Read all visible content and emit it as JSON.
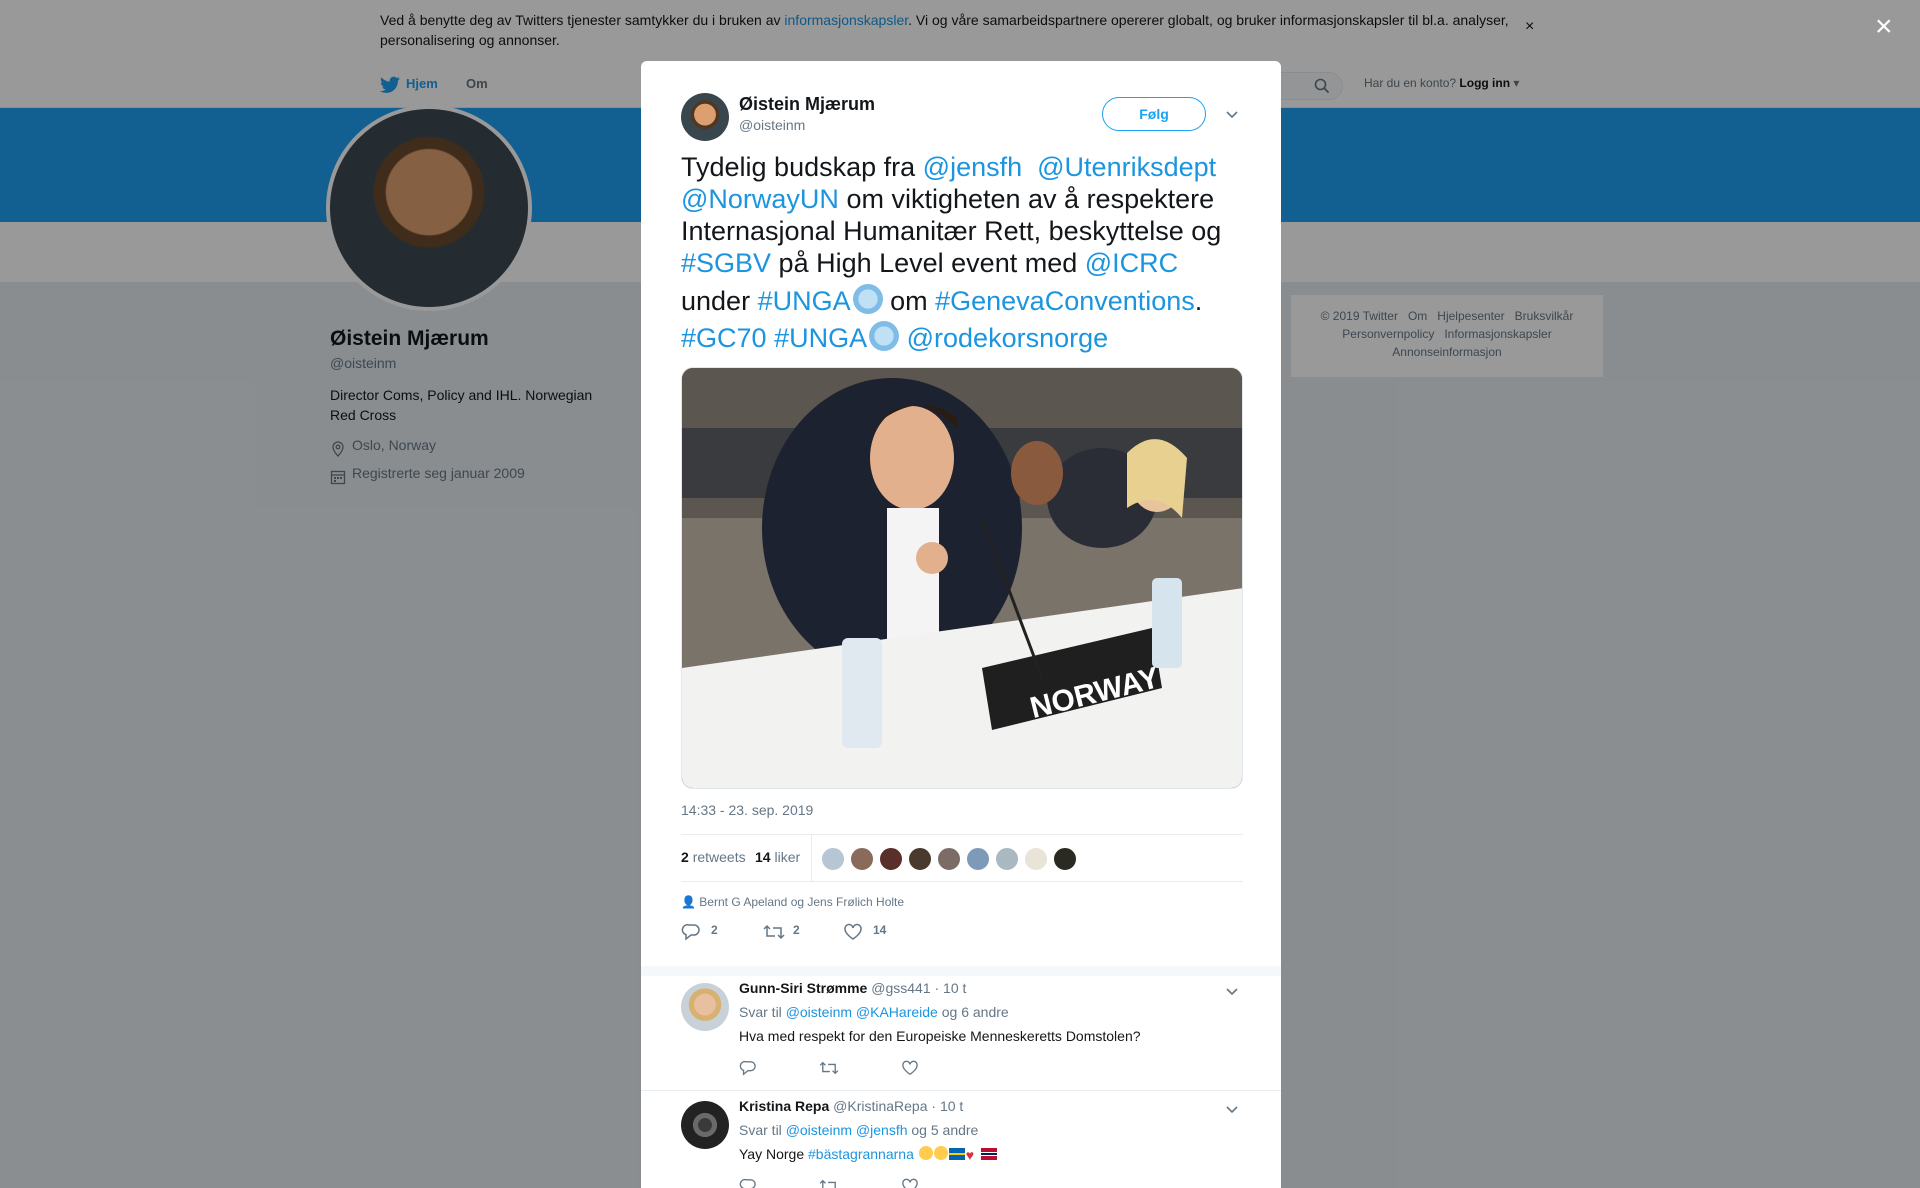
{
  "cookie": {
    "text_before": "Ved å benytte deg av Twitters tjenester samtykker du i bruken av ",
    "link": "informasjonskapsler",
    "text_after": ". Vi og våre samarbeidspartnere opererer globalt, og bruker informasjonskapsler til bl.a. analyser, personalisering og annonser.",
    "close_glyph": "×"
  },
  "nav": {
    "home": "Hjem",
    "about": "Om",
    "have_account": "Har du en konto?",
    "login": "Logg inn"
  },
  "profile": {
    "name": "Øistein Mjærum",
    "handle": "@oisteinm",
    "bio": "Director Coms, Policy and IHL. Norwegian Red Cross",
    "location": "Oslo, Norway",
    "joined": "Registrerte seg januar 2009"
  },
  "footer": {
    "links": [
      "© 2019 Twitter",
      "Om",
      "Hjelpesenter",
      "Bruksvilkår",
      "Personvernpolicy",
      "Informasjonskapsler",
      "Annonseinformasjon"
    ]
  },
  "modal_close": "×",
  "tweet": {
    "author_name": "Øistein Mjærum",
    "author_handle": "@oisteinm",
    "follow_label": "Følg",
    "line1": {
      "a": "Tydelig budskap fra ",
      "b": "@jensfh",
      "c": "  ",
      "d": "@Utenriksdept"
    },
    "line2": {
      "a": "@NorwayUN",
      "b": " om viktigheten av å respektere"
    },
    "line3": "Internasjonal Humanitær Rett, beskyttelse og",
    "line4": {
      "a": "#SGBV",
      "b": " på High Level event med ",
      "c": "@ICRC"
    },
    "line5": {
      "a": "under ",
      "b": "#UNGA",
      "c": " om ",
      "d": "#GenevaConventions",
      "e": "."
    },
    "line6": {
      "a": "#GC70",
      "b": " ",
      "c": "#UNGA",
      "d": " ",
      "e": "@rodekorsnorge"
    },
    "photo_placard": "NORWAY",
    "timestamp": "14:33 - 23. sep. 2019",
    "retweets_count": "2",
    "retweets_label": "retweets",
    "likes_count": "14",
    "likes_label": "liker",
    "retweeted_by": "Bernt G Apeland og Jens Frølich Holte",
    "reply_count": "2",
    "retweet_count": "2",
    "like_count": "14"
  },
  "replies": [
    {
      "name": "Gunn-Siri Strømme",
      "handle": "@gss441",
      "time": "· 10 t",
      "reply_to_label": "Svar til",
      "reply_to_mentions": "@oisteinm @KAHareide",
      "reply_to_others": "og 6 andre",
      "text": "Hva med respekt for den Europeiske Menneskeretts Domstolen?"
    },
    {
      "name": "Kristina Repa",
      "handle": "@KristinaRepa",
      "time": "· 10 t",
      "reply_to_label": "Svar til",
      "reply_to_mentions": "@oisteinm @jensfh",
      "reply_to_others": "og 5 andre",
      "text_before": "Yay Norge ",
      "hashtag": "#bästagrannarna"
    }
  ],
  "colors": {
    "accent": "#1da1f2",
    "link": "#1b95e0",
    "muted": "#657786"
  }
}
